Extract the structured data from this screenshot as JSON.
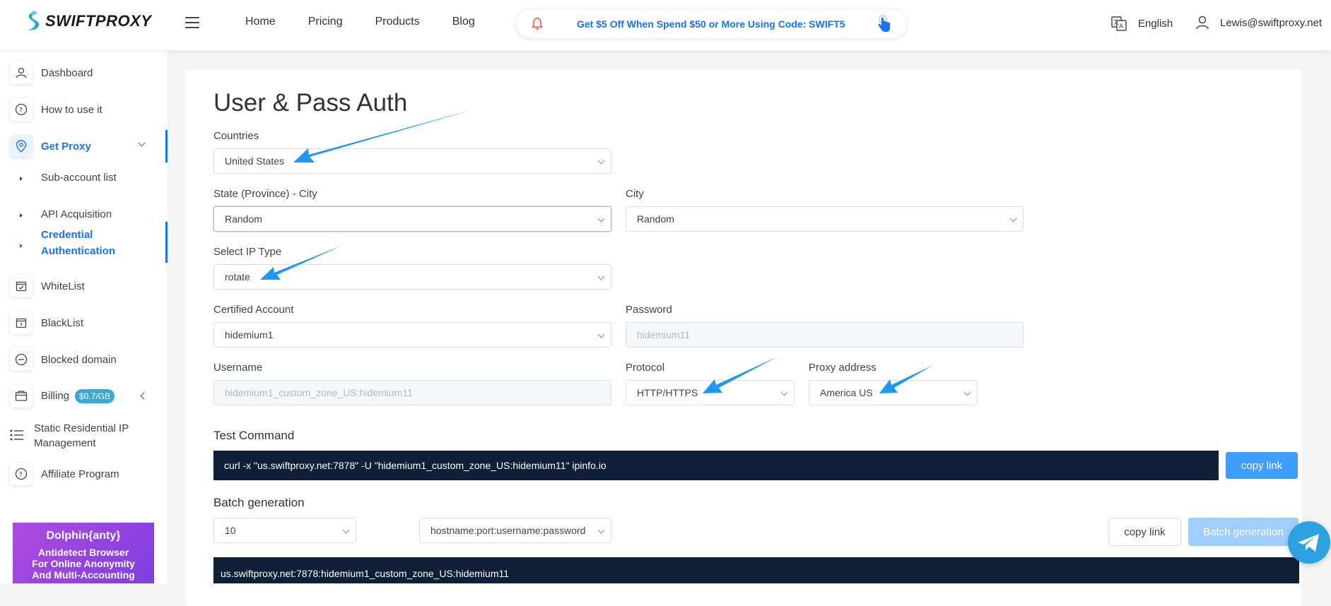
{
  "brand": {
    "name": "SWIFTPROXY"
  },
  "nav": {
    "items": [
      "Home",
      "Pricing",
      "Products",
      "Blog"
    ]
  },
  "promo": {
    "text": "Get $5 Off When Spend $50 or More Using Code: SWIFT5"
  },
  "header": {
    "language": "English",
    "user_email": "Lewis@swiftproxy.net"
  },
  "sidebar": {
    "dashboard": "Dashboard",
    "how_to": "How to use it",
    "get_proxy": "Get Proxy",
    "sub_account": "Sub-account list",
    "api": "API Acquisition",
    "credential_1": "Credential",
    "credential_2": "Authentication",
    "whitelist": "WhiteList",
    "blacklist": "BlackList",
    "blocked": "Blocked domain",
    "billing": "Billing",
    "billing_badge": "$0.7/GB",
    "static_1": "Static Residential IP",
    "static_2": "Management",
    "affiliate": "Affiliate Program"
  },
  "ad": {
    "brand": "Dolphin{anty}",
    "line1": "Antidetect Browser",
    "line2": "For Online Anonymity",
    "line3": "And Multi-Accounting"
  },
  "page": {
    "title": "User & Pass Auth"
  },
  "form": {
    "countries_label": "Countries",
    "countries_value": "United States",
    "state_label": "State (Province) - City",
    "state_value": "Random",
    "city_label": "City",
    "city_value": "Random",
    "ip_type_label": "Select IP Type",
    "ip_type_value": "rotate",
    "account_label": "Certified Account",
    "account_value": "hidemium1",
    "password_label": "Password",
    "password_value": "hidemium11",
    "username_label": "Username",
    "username_value": "hidemium1_custom_zone_US:hidemium11",
    "protocol_label": "Protocol",
    "protocol_value": "HTTP/HTTPS",
    "proxy_label": "Proxy address",
    "proxy_value": "America US"
  },
  "test": {
    "label": "Test Command",
    "command": "curl -x \"us.swiftproxy.net:7878\" -U \"hidemium1_custom_zone_US:hidemium11\" ipinfo.io",
    "copy_label": "copy link"
  },
  "batch": {
    "label": "Batch generation",
    "count": "10",
    "format": "hostname:port:username:password",
    "copy_label": "copy link",
    "generate_label": "Batch generation",
    "output": "us.swiftproxy.net:7878:hidemium1_custom_zone_US:hidemium11"
  },
  "colors": {
    "accent": "#1a73e8",
    "button": "#409eff",
    "dark_box": "#0e1f38",
    "arrow": "#2196f3"
  }
}
